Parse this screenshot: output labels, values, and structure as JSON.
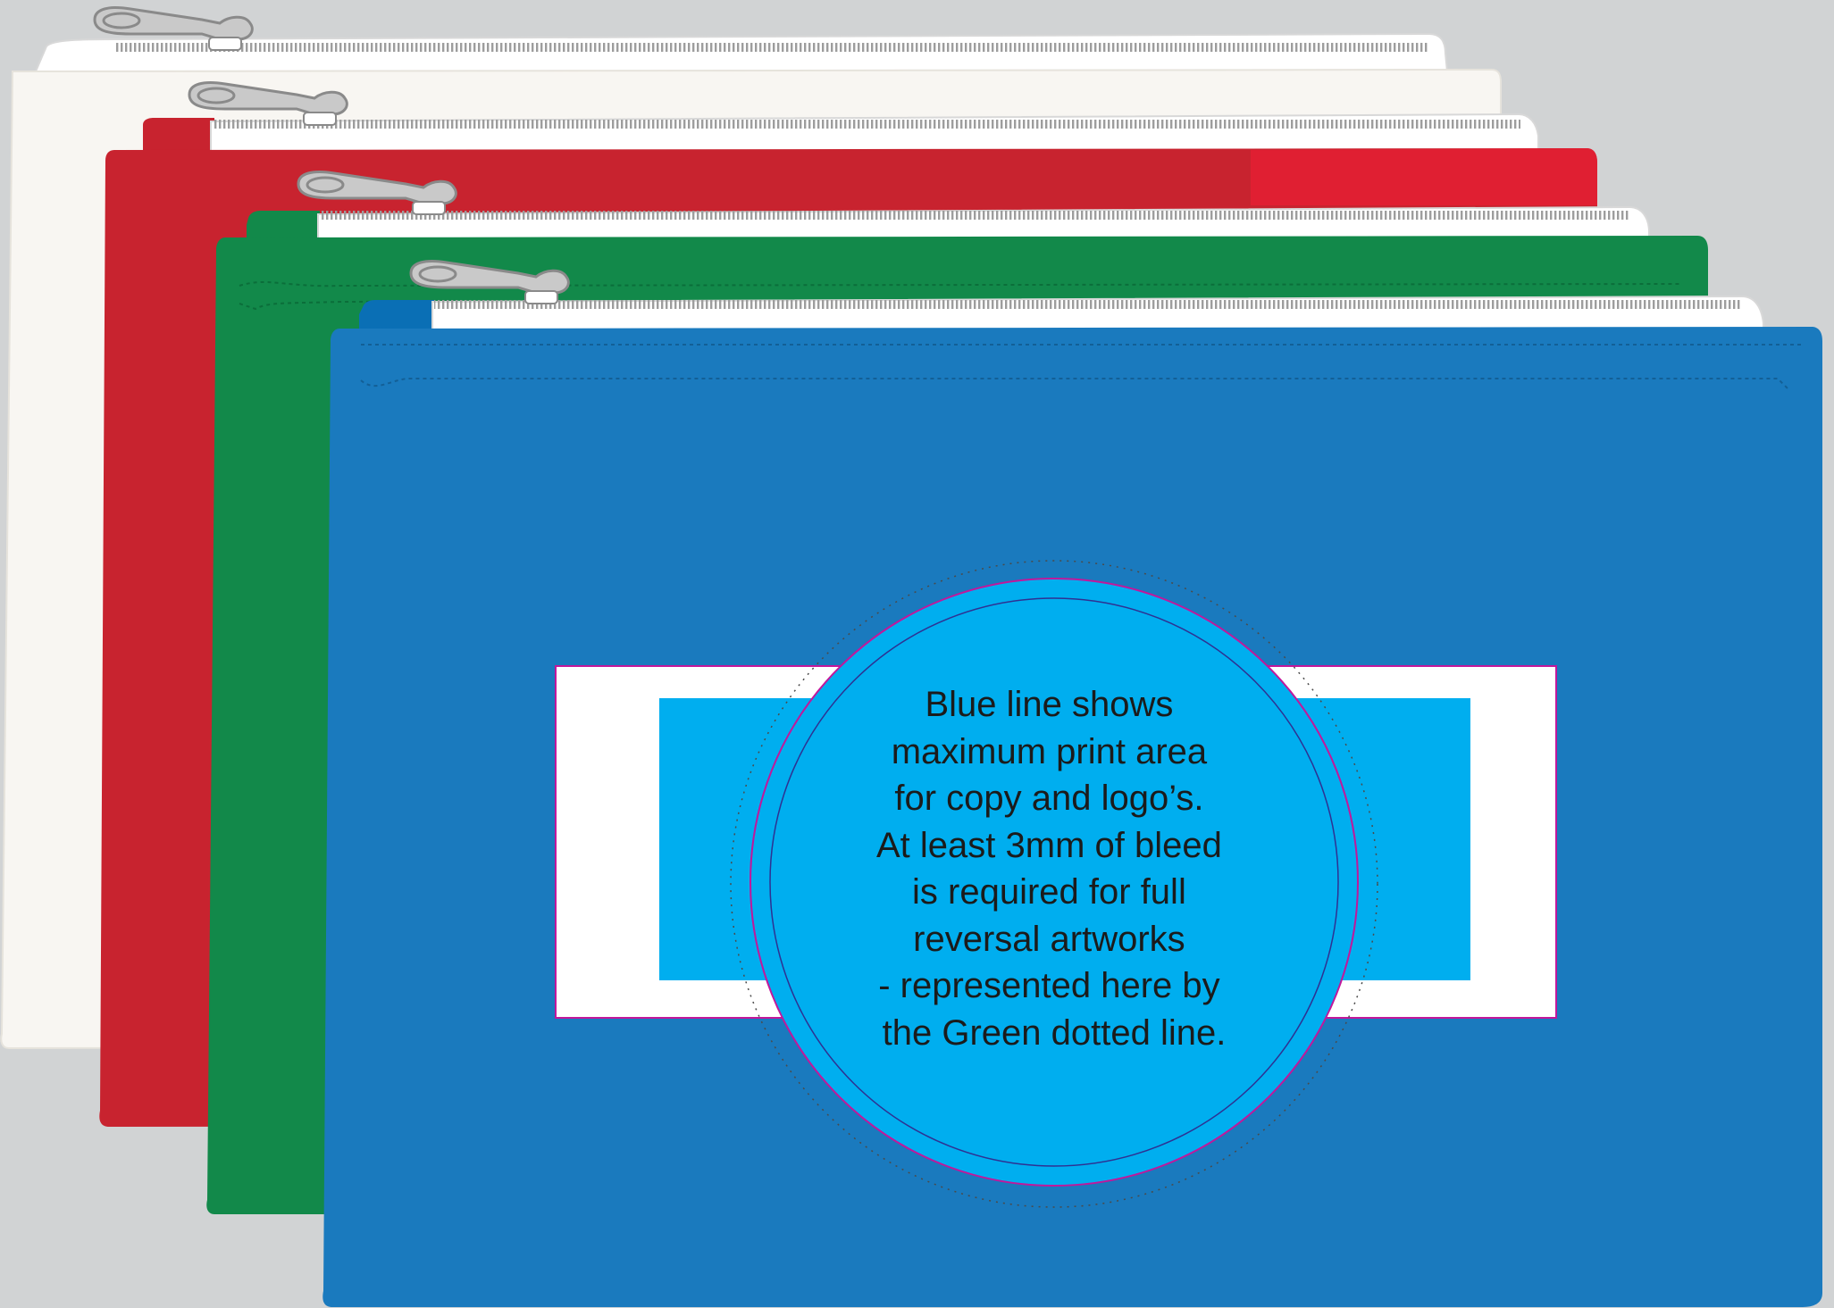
{
  "diagram": {
    "subject": "zipped pouch print template",
    "pouches": [
      {
        "color_name": "white",
        "body_color": "#f8f6f2",
        "tab_color": "#f8f6f2"
      },
      {
        "color_name": "red",
        "body_color": "#c8232f",
        "tab_color": "#c8232f"
      },
      {
        "color_name": "green",
        "body_color": "#12894a",
        "tab_color": "#12894a"
      },
      {
        "color_name": "blue",
        "body_color": "#1a7abe",
        "tab_color": "#0a6fb5"
      }
    ],
    "print_area": {
      "max_area_color": "#00aeef",
      "bleed_box_color": "#ffffff",
      "bleed_outline_color": "#c2179b"
    },
    "note": {
      "lines": [
        "Blue line shows",
        "maximum print area",
        "for copy and logo’s.",
        "At least 3mm of bleed",
        "is required for full",
        "reversal artworks",
        "- represented here by",
        "the Green dotted line."
      ],
      "fill_color": "#00aeef",
      "ring_color": "#2e3192",
      "outline_color": "#c2179b"
    }
  }
}
